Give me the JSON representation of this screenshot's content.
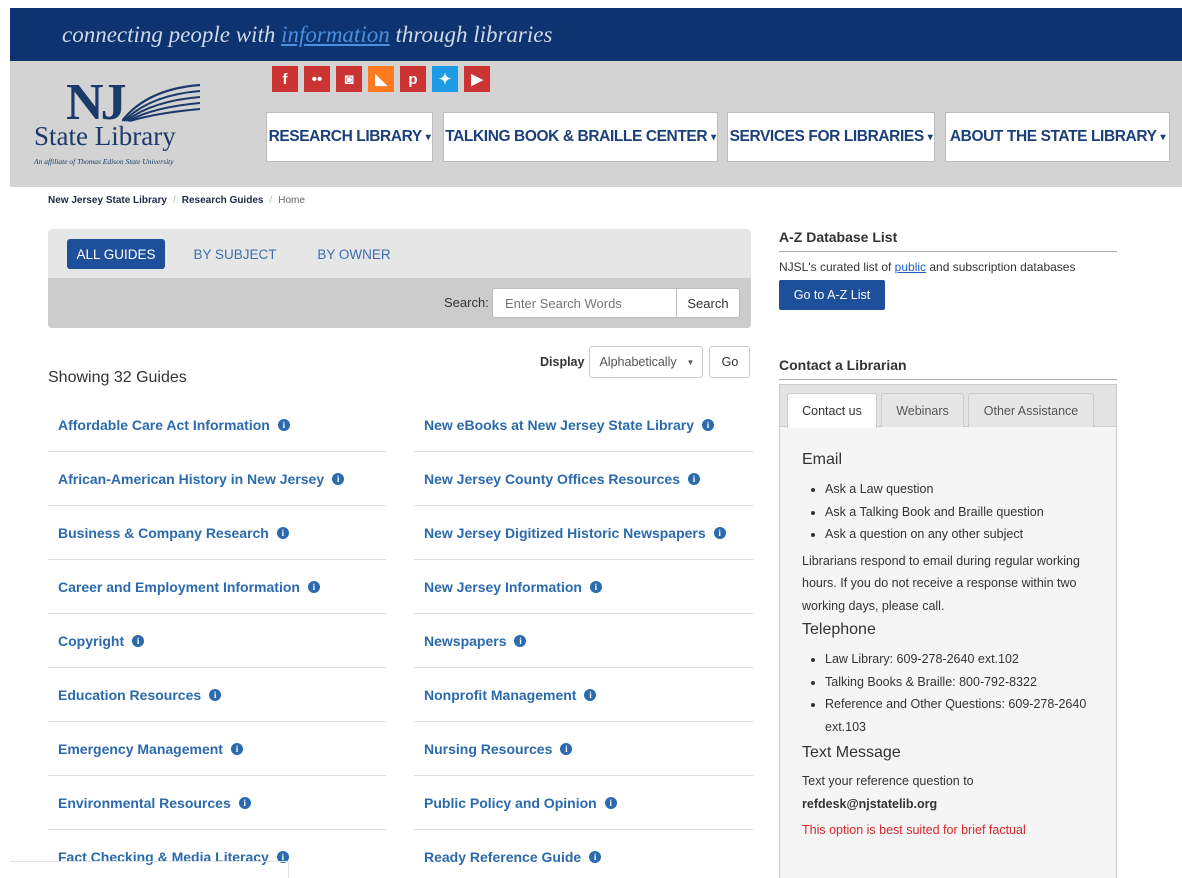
{
  "tagline": {
    "before": "connecting people with ",
    "link": "information",
    "after": " through libraries"
  },
  "logo": {
    "nj": "NJ",
    "name": "State Library",
    "affiliate": "An affiliate of Thomas Edison State University"
  },
  "social": [
    {
      "icon": "facebook-icon",
      "glyph": "f",
      "color": "#cc3333"
    },
    {
      "icon": "flickr-icon",
      "glyph": "••",
      "color": "#cc3333"
    },
    {
      "icon": "instagram-icon",
      "glyph": "◙",
      "color": "#cc3333"
    },
    {
      "icon": "rss-icon",
      "glyph": "◣",
      "color": "#ff7a1f"
    },
    {
      "icon": "pinterest-icon",
      "glyph": "p",
      "color": "#cc3333"
    },
    {
      "icon": "twitter-icon",
      "glyph": "✦",
      "color": "#1e9be6"
    },
    {
      "icon": "youtube-icon",
      "glyph": "▶",
      "color": "#cc3333"
    }
  ],
  "nav": [
    {
      "label": "RESEARCH LIBRARY"
    },
    {
      "label": "TALKING BOOK & BRAILLE CENTER"
    },
    {
      "label": "SERVICES FOR LIBRARIES"
    },
    {
      "label": "ABOUT THE STATE LIBRARY"
    }
  ],
  "breadcrumb": {
    "item1": "New Jersey State Library",
    "item2": "Research Guides",
    "current": "Home"
  },
  "guide_tabs": {
    "all": "ALL GUIDES",
    "subject": "BY SUBJECT",
    "owner": "BY OWNER"
  },
  "search": {
    "label": "Search:",
    "placeholder": "Enter Search Words",
    "button": "Search"
  },
  "display": {
    "label": "Display",
    "selected": "Alphabetically",
    "go": "Go"
  },
  "showing": "Showing 32 Guides",
  "guides_left": [
    "Affordable Care Act Information",
    "African-American History in New Jersey",
    "Business & Company Research",
    "Career and Employment Information",
    "Copyright",
    "Education Resources",
    "Emergency Management",
    "Environmental Resources",
    "Fact Checking & Media Literacy"
  ],
  "guides_right": [
    "New eBooks at New Jersey State Library",
    "New Jersey County Offices Resources",
    "New Jersey Digitized Historic Newspapers",
    "New Jersey Information",
    "Newspapers",
    "Nonprofit Management",
    "Nursing Resources",
    "Public Policy and Opinion",
    "Ready Reference Guide"
  ],
  "az": {
    "heading": "A-Z Database List",
    "text_before": "NJSL's curated list of ",
    "link": "public",
    "text_after": " and subscription databases",
    "button": "Go to A-Z List"
  },
  "contact": {
    "heading": "Contact a Librarian",
    "tabs": [
      "Contact us",
      "Webinars",
      "Other Assistance"
    ],
    "email_heading": "Email",
    "email_items": [
      "Ask a Law question",
      "Ask a Talking Book and Braille question",
      "Ask a question on any other subject"
    ],
    "email_note": "Librarians respond to email during regular working hours. If you do not receive a response within two working days, please call.",
    "phone_heading": "Telephone",
    "phone_items": [
      "Law Library: 609-278-2640 ext.102",
      "Talking Books & Braille: 800-792-8322",
      "Reference and Other Questions: 609-278-2640 ext.103"
    ],
    "text_heading": "Text Message",
    "text_note": "Text your reference question to",
    "text_address": "refdesk@njstatelib.org",
    "text_warning": "This option is best suited for brief factual"
  }
}
